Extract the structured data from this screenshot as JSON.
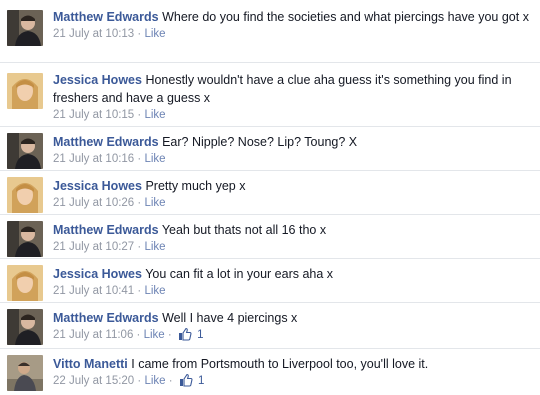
{
  "comments": [
    {
      "author": "Matthew Edwards",
      "text": "Where do you find the societies and what piercings have you got x",
      "time": "21 July at 10:13",
      "action": "Like",
      "likes": null,
      "avatar": "matthew-avatar"
    },
    {
      "author": "Jessica Howes",
      "text": "Honestly wouldn't have a clue aha guess it's something you find in freshers and have a guess x",
      "time": "21 July at 10:15",
      "action": "Like",
      "likes": null,
      "avatar": "jessica-avatar"
    },
    {
      "author": "Matthew Edwards",
      "text": "Ear? Nipple? Nose? Lip? Toung? X",
      "time": "21 July at 10:16",
      "action": "Like",
      "likes": null,
      "avatar": "matthew-avatar"
    },
    {
      "author": "Jessica Howes",
      "text": "Pretty much yep x",
      "time": "21 July at 10:26",
      "action": "Like",
      "likes": null,
      "avatar": "jessica-avatar"
    },
    {
      "author": "Matthew Edwards",
      "text": "Yeah but thats not all 16 tho x",
      "time": "21 July at 10:27",
      "action": "Like",
      "likes": null,
      "avatar": "matthew-avatar"
    },
    {
      "author": "Jessica Howes",
      "text": "You can fit a lot in your ears aha x",
      "time": "21 July at 10:41",
      "action": "Like",
      "likes": null,
      "avatar": "jessica-avatar"
    },
    {
      "author": "Matthew Edwards",
      "text": "Well I have 4 piercings x",
      "time": "21 July at 11:06",
      "action": "Like",
      "likes": "1",
      "avatar": "matthew-avatar"
    },
    {
      "author": "Vitto Manetti",
      "text": "I came from Portsmouth to Liverpool too, you'll love it.",
      "time": "22 July at 15:20",
      "action": "Like",
      "likes": "1",
      "avatar": "vitto-avatar"
    }
  ],
  "separator": "·",
  "colors": {
    "author": "#3b5998",
    "text": "#141823",
    "meta": "#9197a3",
    "like_link": "#6d84b4",
    "divider": "#e3e6ea"
  },
  "icons": {
    "like_count": "thumbs-up-icon"
  }
}
